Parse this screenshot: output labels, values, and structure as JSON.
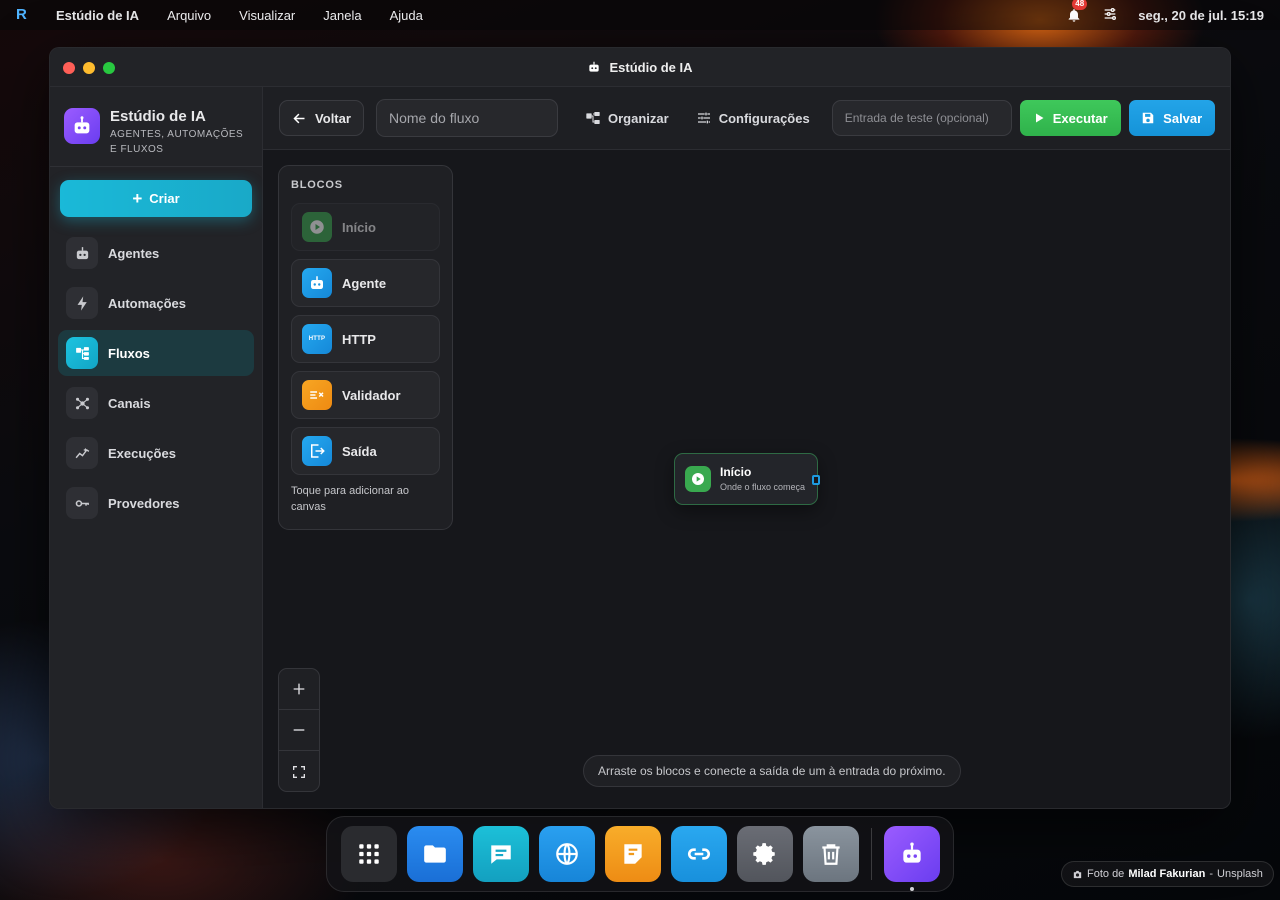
{
  "menubar": {
    "logo": "R",
    "app_name": "Estúdio de IA",
    "menus": [
      "Arquivo",
      "Visualizar",
      "Janela",
      "Ajuda"
    ],
    "notification_count": "48",
    "clock": "seg., 20 de jul. 15:19"
  },
  "window": {
    "title": "Estúdio de IA"
  },
  "sidebar": {
    "brand_title": "Estúdio de IA",
    "brand_subtitle": "AGENTES, AUTOMAÇÕES E FLUXOS",
    "create_label": "Criar",
    "items": [
      {
        "label": "Agentes",
        "icon": "robot-icon"
      },
      {
        "label": "Automações",
        "icon": "bolt-icon"
      },
      {
        "label": "Fluxos",
        "icon": "flow-icon",
        "active": true
      },
      {
        "label": "Canais",
        "icon": "hub-icon"
      },
      {
        "label": "Execuções",
        "icon": "chart-icon"
      },
      {
        "label": "Provedores",
        "icon": "key-icon"
      }
    ]
  },
  "toolbar": {
    "back_label": "Voltar",
    "flow_name_placeholder": "Nome do fluxo",
    "organize_label": "Organizar",
    "settings_label": "Configurações",
    "test_input_placeholder": "Entrada de teste (opcional)",
    "run_label": "Executar",
    "save_label": "Salvar"
  },
  "blocks": {
    "title": "BLOCOS",
    "items": [
      {
        "label": "Início",
        "icon": "play-icon",
        "disabled": true
      },
      {
        "label": "Agente",
        "icon": "robot-icon"
      },
      {
        "label": "HTTP",
        "icon": "http-icon",
        "icon_text": "HTTP"
      },
      {
        "label": "Validador",
        "icon": "validator-icon"
      },
      {
        "label": "Saída",
        "icon": "exit-icon"
      }
    ],
    "hint": "Toque para adicionar ao canvas"
  },
  "node": {
    "title": "Início",
    "subtitle": "Onde o fluxo começa"
  },
  "canvas": {
    "hint": "Arraste os blocos e conecte a saída de um à entrada do próximo."
  },
  "credit": {
    "prefix": "Foto de",
    "author": "Milad Fakurian",
    "separator": "-",
    "source": "Unsplash"
  },
  "colors": {
    "accent_cyan": "#1ab9d8",
    "run_green": "#3fc85b",
    "save_blue": "#23a4e8",
    "brand_purple": "#8a4dff"
  }
}
